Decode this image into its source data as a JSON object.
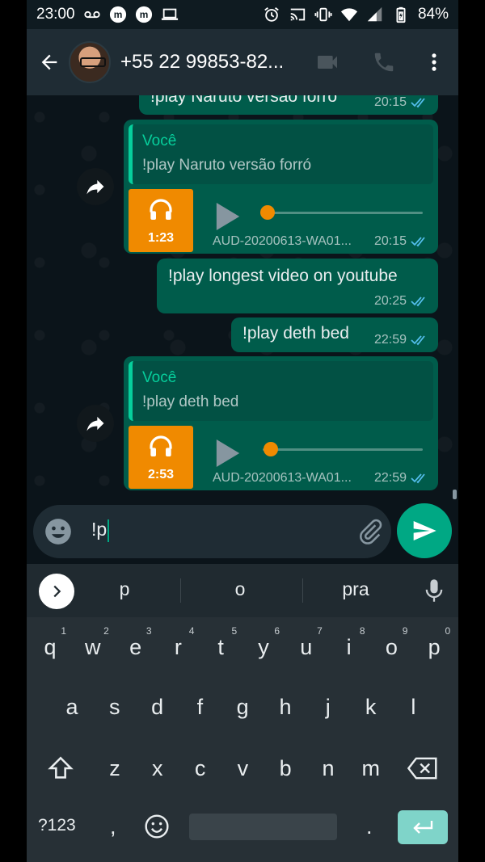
{
  "status_bar": {
    "time": "23:00",
    "battery": "84%",
    "left_icons": [
      "voicemail-icon",
      "m-app-icon",
      "m-app-icon",
      "laptop-icon"
    ],
    "right_icons": [
      "alarm-icon",
      "cast-icon",
      "vibrate-icon",
      "wifi-icon",
      "signal-icon",
      "battery-icon"
    ]
  },
  "header": {
    "contact_name": "+55 22 99853-82...",
    "icons": [
      "back-arrow-icon",
      "video-call-icon",
      "voice-call-icon",
      "more-vert-icon"
    ]
  },
  "messages": [
    {
      "type": "text",
      "text": "!play Naruto versão forró",
      "time": "20:15"
    },
    {
      "type": "audio_reply",
      "quote_author": "Você",
      "quote_text": "!play Naruto versão forró",
      "duration": "1:23",
      "file_name": "AUD-20200613-WA01...",
      "time": "20:15",
      "progress": 0.03
    },
    {
      "type": "text",
      "text": "!play longest video on youtube",
      "time": "20:25"
    },
    {
      "type": "text",
      "text": "!play deth bed",
      "time": "22:59"
    },
    {
      "type": "audio_reply",
      "quote_author": "Você",
      "quote_text": "!play deth bed",
      "duration": "2:53",
      "file_name": "AUD-20200613-WA01...",
      "time": "22:59",
      "progress": 0.05
    }
  ],
  "input": {
    "value": "!p"
  },
  "keyboard": {
    "suggestions": [
      "p",
      "o",
      "pra"
    ],
    "row1": [
      {
        "k": "q",
        "n": "1"
      },
      {
        "k": "w",
        "n": "2"
      },
      {
        "k": "e",
        "n": "3"
      },
      {
        "k": "r",
        "n": "4"
      },
      {
        "k": "t",
        "n": "5"
      },
      {
        "k": "y",
        "n": "6"
      },
      {
        "k": "u",
        "n": "7"
      },
      {
        "k": "i",
        "n": "8"
      },
      {
        "k": "o",
        "n": "9"
      },
      {
        "k": "p",
        "n": "0"
      }
    ],
    "row2": [
      "a",
      "s",
      "d",
      "f",
      "g",
      "h",
      "j",
      "k",
      "l"
    ],
    "row3": [
      "z",
      "x",
      "c",
      "v",
      "b",
      "n",
      "m"
    ],
    "symbols_label": "?123",
    "comma": ",",
    "period": "."
  },
  "colors": {
    "outgoing_bubble": "#005c4b",
    "accent": "#00a884",
    "audio_thumb": "#f08a00",
    "header": "#1f2c34",
    "read_ticks": "#53bdeb"
  }
}
